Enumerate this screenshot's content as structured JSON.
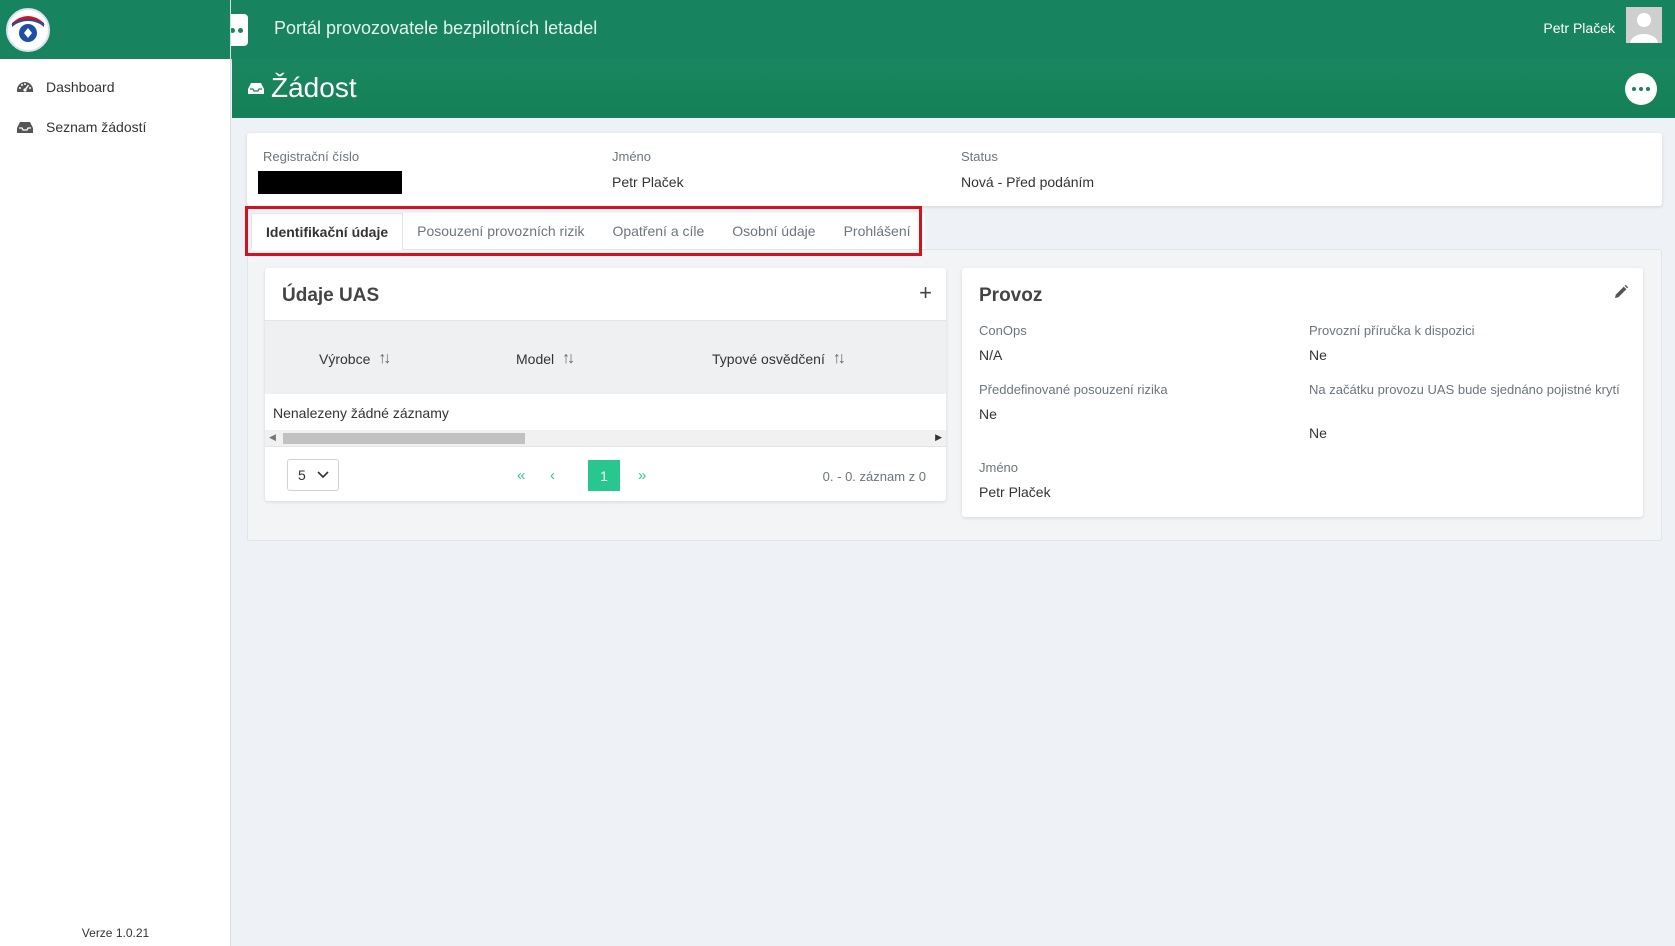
{
  "app": {
    "title": "Portál provozovatele bezpilotních letadel",
    "user_name": "Petr Plaček"
  },
  "sidebar": {
    "items": [
      {
        "label": "Dashboard",
        "icon": "tachometer-icon"
      },
      {
        "label": "Seznam žádostí",
        "icon": "inbox-icon"
      }
    ],
    "version": "Verze 1.0.21"
  },
  "page": {
    "title": "Žádost"
  },
  "info": {
    "reg_label": "Registrační číslo",
    "name_label": "Jméno",
    "name_value": "Petr Plaček",
    "status_label": "Status",
    "status_value": "Nová - Před podáním"
  },
  "tabs": [
    {
      "label": "Identifikační údaje",
      "active": true
    },
    {
      "label": "Posouzení provozních rizik",
      "active": false
    },
    {
      "label": "Opatření a cíle",
      "active": false
    },
    {
      "label": "Osobní údaje",
      "active": false
    },
    {
      "label": "Prohlášení",
      "active": false
    }
  ],
  "uas": {
    "title": "Údaje UAS",
    "add": "+",
    "columns": [
      "Výrobce",
      "Model",
      "Typové osvědčení"
    ],
    "empty": "Nenalezeny žádné záznamy",
    "page_size": "5",
    "current_page": "1",
    "page_info": "0. - 0. záznam z 0"
  },
  "provoz": {
    "title": "Provoz",
    "fields": [
      {
        "label": "ConOps",
        "value": "N/A"
      },
      {
        "label": "Provozní příručka k dispozici",
        "value": "Ne"
      },
      {
        "label": "Předdefinované posouzení rizika",
        "value": "Ne"
      },
      {
        "label": "Na začátku provozu UAS bude sjednáno pojistné krytí",
        "value": "Ne"
      },
      {
        "label": "Jméno",
        "value": "Petr Plaček"
      }
    ]
  },
  "colors": {
    "primary": "#17845f",
    "accent": "#28c78f",
    "highlight": "#d4111f"
  }
}
